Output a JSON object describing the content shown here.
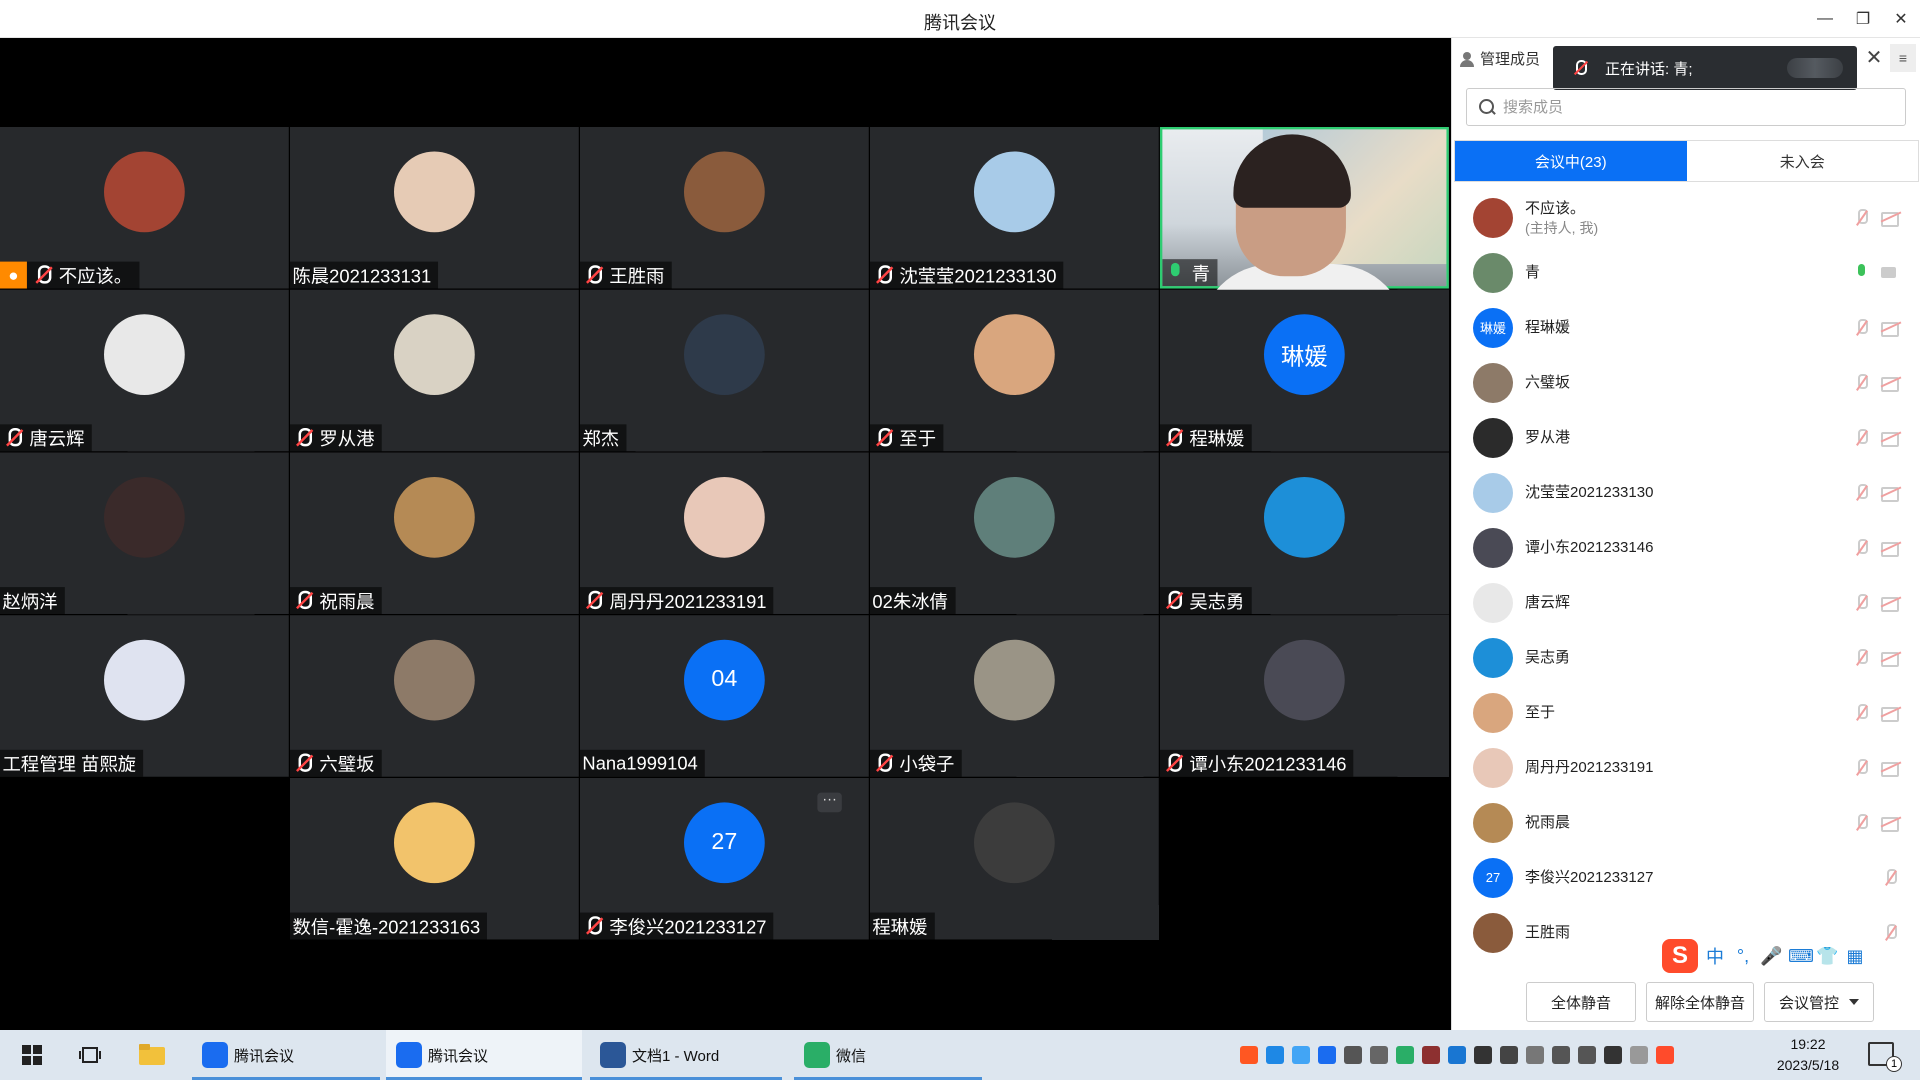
{
  "window": {
    "title": "腾讯会议"
  },
  "tiles": [
    {
      "name": "不应该。",
      "mic": "off",
      "host": true,
      "avatar_color": "#a34433"
    },
    {
      "name": "陈晨2021233131",
      "mic": "none",
      "avatar_color": "#e6cbb5"
    },
    {
      "name": "王胜雨",
      "mic": "off",
      "avatar_color": "#8a5b3c"
    },
    {
      "name": "沈莹莹2021233130",
      "mic": "off",
      "avatar_color": "#a8cbe8"
    },
    {
      "name": "青",
      "mic": "on",
      "camera": true
    },
    {
      "name": "唐云辉",
      "mic": "off",
      "avatar_color": "#e8e8e8"
    },
    {
      "name": "罗从港",
      "mic": "off",
      "avatar_color": "#d9d2c4"
    },
    {
      "name": "郑杰",
      "mic": "none",
      "avatar_color": "#2e3a4a"
    },
    {
      "name": "至于",
      "mic": "off",
      "avatar_color": "#d9a67e"
    },
    {
      "name": "程琳媛",
      "mic": "off",
      "avatar_text": "琳媛",
      "avatar_color": "#0a70f5"
    },
    {
      "name": "赵炳洋",
      "mic": "none",
      "avatar_color": "#3a2a2a"
    },
    {
      "name": "祝雨晨",
      "mic": "off",
      "avatar_color": "#b58a55"
    },
    {
      "name": "周丹丹2021233191",
      "mic": "off",
      "avatar_color": "#e8c8b8"
    },
    {
      "name": "02朱冰倩",
      "mic": "none",
      "avatar_color": "#5f7f7a"
    },
    {
      "name": "吴志勇",
      "mic": "off",
      "avatar_color": "#1d8fd8"
    },
    {
      "name": "工程管理 苗熙旋",
      "mic": "none",
      "avatar_color": "#dfe3f0"
    },
    {
      "name": "六璧坂",
      "mic": "off",
      "avatar_color": "#8d7a68"
    },
    {
      "name": "Nana1999104",
      "mic": "none",
      "avatar_text": "04",
      "avatar_color": "#0a70f5"
    },
    {
      "name": "小袋子",
      "mic": "off",
      "avatar_color": "#9a9486"
    },
    {
      "name": "谭小东2021233146",
      "mic": "off",
      "avatar_color": "#4a4a55"
    },
    {
      "name": "数信-霍逸-2021233163",
      "mic": "none",
      "avatar_color": "#f2c36b"
    },
    {
      "name": "李俊兴2021233127",
      "mic": "off",
      "avatar_text": "27",
      "avatar_color": "#0a70f5",
      "more": "···"
    },
    {
      "name": "程琳媛",
      "mic": "none",
      "avatar_color": "#3c3c3c"
    }
  ],
  "panel": {
    "manage_label": "管理成员",
    "speaking_text": "正在讲话: 青;",
    "close_glyph": "✕",
    "menu_glyph": "≡",
    "search_placeholder": "搜索成员",
    "tabs": {
      "in_meeting": "会议中(23)",
      "not_joined": "未入会"
    },
    "members": [
      {
        "name": "不应该。",
        "sub": "(主持人, 我)",
        "mic": "off",
        "cam": "off",
        "avatar_color": "#a34433"
      },
      {
        "name": "青",
        "sub": "",
        "mic": "on",
        "cam": "on",
        "avatar_color": "#6a8a6a"
      },
      {
        "name": "程琳媛",
        "sub": "",
        "mic": "off",
        "cam": "off",
        "avatar_text": "琳媛",
        "avatar_color": "#0a70f5"
      },
      {
        "name": "六璧坂",
        "sub": "",
        "mic": "off",
        "cam": "off",
        "avatar_color": "#8d7a68"
      },
      {
        "name": "罗从港",
        "sub": "",
        "mic": "off",
        "cam": "off",
        "avatar_color": "#2b2b2b"
      },
      {
        "name": "沈莹莹2021233130",
        "sub": "",
        "mic": "off",
        "cam": "off",
        "avatar_color": "#a8cbe8"
      },
      {
        "name": "谭小东2021233146",
        "sub": "",
        "mic": "off",
        "cam": "off",
        "avatar_color": "#4a4a55"
      },
      {
        "name": "唐云辉",
        "sub": "",
        "mic": "off",
        "cam": "off",
        "avatar_color": "#e8e8e8"
      },
      {
        "name": "吴志勇",
        "sub": "",
        "mic": "off",
        "cam": "off",
        "avatar_color": "#1d8fd8"
      },
      {
        "name": "至于",
        "sub": "",
        "mic": "off",
        "cam": "off",
        "avatar_color": "#d9a67e"
      },
      {
        "name": "周丹丹2021233191",
        "sub": "",
        "mic": "off",
        "cam": "off",
        "avatar_color": "#e8c8b8"
      },
      {
        "name": "祝雨晨",
        "sub": "",
        "mic": "off",
        "cam": "off",
        "avatar_color": "#b58a55"
      },
      {
        "name": "李俊兴2021233127",
        "sub": "",
        "mic": "off",
        "cam": "none",
        "avatar_text": "27",
        "avatar_color": "#0a70f5"
      },
      {
        "name": "王胜雨",
        "sub": "",
        "mic": "off",
        "cam": "none",
        "avatar_color": "#8a5b3c"
      }
    ],
    "ime": {
      "logo": "S",
      "glyphs": [
        "中",
        "°,",
        "🎤",
        "⌨",
        "👕",
        "▦"
      ]
    },
    "buttons": {
      "mute_all": "全体静音",
      "unmute_all": "解除全体静音",
      "control": "会议管控"
    }
  },
  "taskbar": {
    "items": [
      {
        "label": "腾讯会议",
        "icon": "tencent-meeting-icon",
        "color": "#1a6cf0"
      },
      {
        "label": "腾讯会议",
        "icon": "tencent-meeting-icon",
        "color": "#1a6cf0"
      },
      {
        "label": "文档1 - Word",
        "icon": "word-icon",
        "color": "#2b5797"
      },
      {
        "label": "微信",
        "icon": "wechat-icon",
        "color": "#2aae67"
      }
    ],
    "time": "19:22",
    "date": "2023/5/18",
    "notifications": "1"
  }
}
